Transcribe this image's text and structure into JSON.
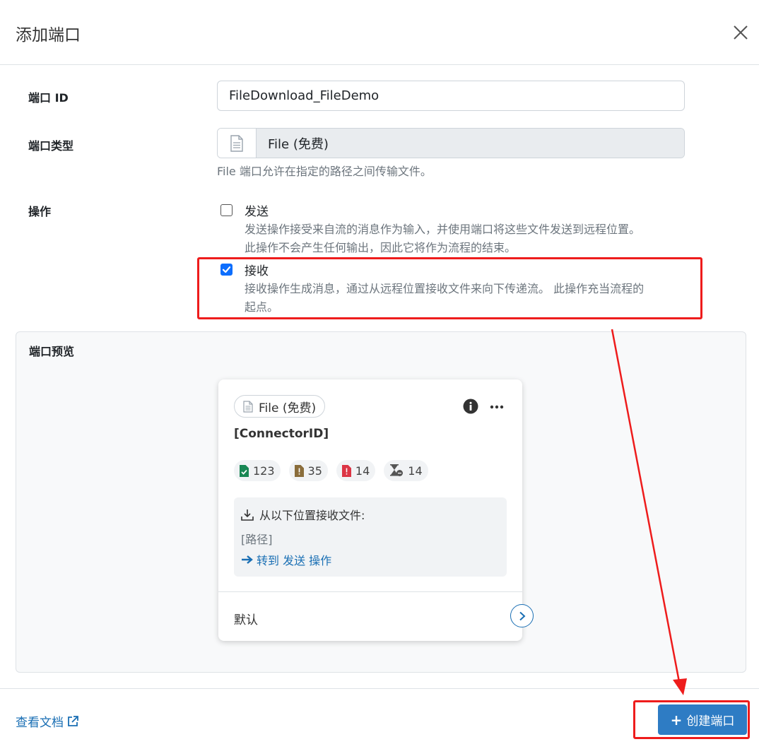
{
  "dialog": {
    "title": "添加端口"
  },
  "form": {
    "connector_id_label": "端口 ID",
    "connector_id_value": "FileDownload_FileDemo",
    "connector_type_label": "端口类型",
    "connector_type_value": "File (免费)",
    "connector_type_help": "File 端口允许在指定的路径之间传输文件。",
    "operations_label": "操作",
    "send": {
      "label": "发送",
      "checked": false,
      "desc_line1": "发送操作接受来自流的消息作为输入，并使用端口将这些文件发送到远程位置。",
      "desc_line2": "此操作不会产生任何输出，因此它将作为流程的结束。"
    },
    "receive": {
      "label": "接收",
      "checked": true,
      "desc_line1": "接收操作生成消息，通过从远程位置接收文件来向下传递流。 此操作充当流程的",
      "desc_line2": "起点。"
    }
  },
  "preview": {
    "title": "端口预览",
    "card": {
      "badge": "File (免费)",
      "connector_id": "[ConnectorID]",
      "stats": {
        "success": "123",
        "pending": "35",
        "error": "14",
        "queued": "14"
      },
      "receive_heading": "从以下位置接收文件:",
      "path": "[路径]",
      "goto_link": "转到 发送 操作",
      "route_label": "默认"
    }
  },
  "footer": {
    "doc_link": "查看文档",
    "create_button": "创建端口"
  },
  "colors": {
    "primary": "#2e7cc4",
    "link": "#1a6fb4",
    "highlight": "#ee1c1c",
    "success": "#198754",
    "warning": "#8a6d3b",
    "danger": "#dc3545"
  }
}
